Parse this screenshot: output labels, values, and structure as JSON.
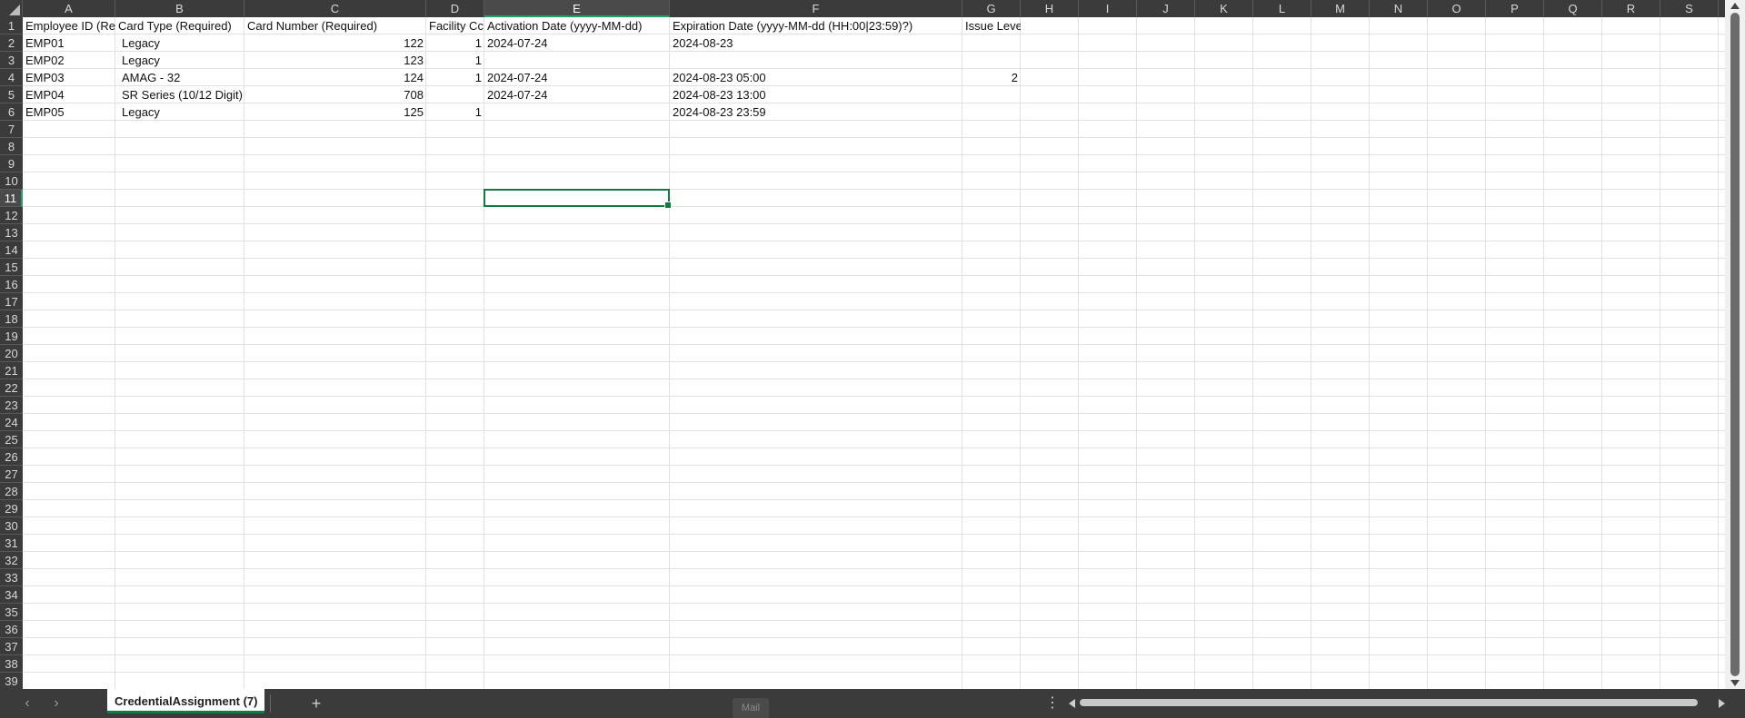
{
  "columns": [
    "A",
    "B",
    "C",
    "D",
    "E",
    "F",
    "G",
    "H",
    "I",
    "J",
    "K",
    "L",
    "M",
    "N",
    "O",
    "P",
    "Q",
    "R",
    "S"
  ],
  "active_column": "E",
  "rows": [
    "1",
    "2",
    "3",
    "4",
    "5",
    "6",
    "7",
    "8",
    "9",
    "10",
    "11",
    "12",
    "13",
    "14",
    "15",
    "16",
    "17",
    "18",
    "19",
    "20",
    "21",
    "22",
    "23",
    "24",
    "25",
    "26",
    "27",
    "28",
    "29",
    "30",
    "31",
    "32",
    "33",
    "34",
    "35",
    "36",
    "37",
    "38",
    "39"
  ],
  "active_row": "11",
  "header_row": {
    "A": "Employee ID (Re",
    "B": "Card Type (Required)",
    "C": "Card Number (Required)",
    "D": "Facility Cc",
    "E": "Activation Date (yyyy-MM-dd)",
    "F": "Expiration Date (yyyy-MM-dd (HH:00|23:59)?)",
    "G": "Issue Level"
  },
  "data_rows": [
    {
      "A": "EMP01",
      "B": "Legacy",
      "C": "122",
      "D": "1",
      "E": "2024-07-24",
      "F": "2024-08-23",
      "G": ""
    },
    {
      "A": "EMP02",
      "B": "Legacy",
      "C": "123",
      "D": "1",
      "E": "",
      "F": "",
      "G": ""
    },
    {
      "A": "EMP03",
      "B": "AMAG - 32",
      "C": "124",
      "D": "1",
      "E": "2024-07-24",
      "F": "2024-08-23 05:00",
      "G": "2"
    },
    {
      "A": "EMP04",
      "B": "SR Series (10/12 Digit)",
      "C": "708",
      "D": "",
      "E": "2024-07-24",
      "F": "2024-08-23 13:00",
      "G": ""
    },
    {
      "A": "EMP05",
      "B": "Legacy",
      "C": "125",
      "D": "1",
      "E": "",
      "F": "2024-08-23 23:59",
      "G": ""
    }
  ],
  "sheet_tab": "CredentialAssignment (7)",
  "add_sheet_label": "+",
  "prev_sheet_label": "‹",
  "next_sheet_label": "›",
  "more_label": "⋮",
  "mail_label": "Mail",
  "accent_color": "#107c41"
}
